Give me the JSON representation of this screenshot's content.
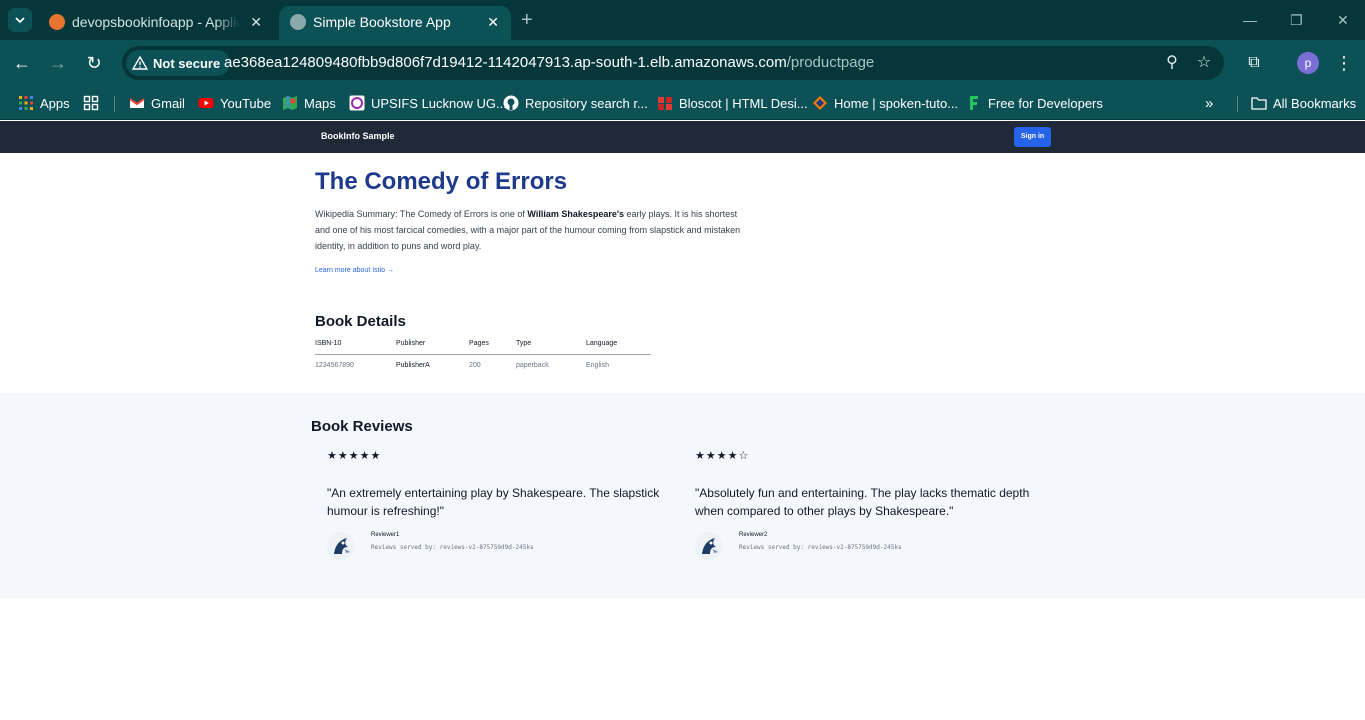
{
  "browser": {
    "tabs": [
      {
        "title": "devopsbookinfoapp - Applicatio",
        "active": false
      },
      {
        "title": "Simple Bookstore App",
        "active": true
      }
    ],
    "security_label": "Not secure",
    "url_host": "ae368ea124809480fbb9d806f7d19412-1142047913.ap-south-1.elb.amazonaws.com",
    "url_path": "/productpage",
    "profile_initial": "p",
    "bookmarks": [
      {
        "label": "Apps",
        "icon": "apps-grid-icon",
        "color": "#f4b400"
      },
      {
        "label": "Gmail",
        "icon": "gmail-icon",
        "color": "#ea4335"
      },
      {
        "label": "YouTube",
        "icon": "youtube-icon",
        "color": "#ff0000"
      },
      {
        "label": "Maps",
        "icon": "maps-icon",
        "color": "#34a853"
      },
      {
        "label": "UPSIFS Lucknow UG...",
        "icon": "upsifs-icon",
        "color": "#9c27b0"
      },
      {
        "label": "Repository search r...",
        "icon": "github-icon",
        "color": "#ffffff"
      },
      {
        "label": "Bloscot | HTML Desi...",
        "icon": "bloscot-icon",
        "color": "#e53935"
      },
      {
        "label": "Home | spoken-tuto...",
        "icon": "spoken-tutorial-icon",
        "color": "#f57c00"
      },
      {
        "label": "Free for Developers",
        "icon": "free-dev-icon",
        "color": "#22c55e"
      }
    ],
    "all_bookmarks": "All Bookmarks"
  },
  "site": {
    "brand": "BookInfo Sample",
    "sign_in": "Sign in"
  },
  "book": {
    "title": "The Comedy of Errors",
    "summary_prefix": "Wikipedia Summary: The Comedy of Errors is one of ",
    "summary_author": "William Shakespeare's",
    "summary_suffix": " early plays. It is his shortest and one of his most farcical comedies, with a major part of the humour coming from slapstick and mistaken identity, in addition to puns and word play.",
    "learn_more": "Learn more about Istio →"
  },
  "details": {
    "heading": "Book Details",
    "columns": [
      "ISBN-10",
      "Publisher",
      "Pages",
      "Type",
      "Language"
    ],
    "values": [
      "1234567890",
      "PublisherA",
      "200",
      "paperback",
      "English"
    ]
  },
  "reviews": {
    "heading": "Book Reviews",
    "items": [
      {
        "stars": "★★★★★",
        "rating": 5,
        "text": "\"An extremely entertaining play by Shakespeare. The slapstick humour is refreshing!\"",
        "reviewer": "Reviewer1",
        "served_by": "Reviews served by: reviews-v2-875759d9d-245ks"
      },
      {
        "stars": "★★★★☆",
        "rating": 4,
        "text": "\"Absolutely fun and entertaining. The play lacks thematic depth when compared to other plays by Shakespeare.\"",
        "reviewer": "Reviewer2",
        "served_by": "Reviews served by: reviews-v2-875759d9d-245ks"
      }
    ]
  }
}
